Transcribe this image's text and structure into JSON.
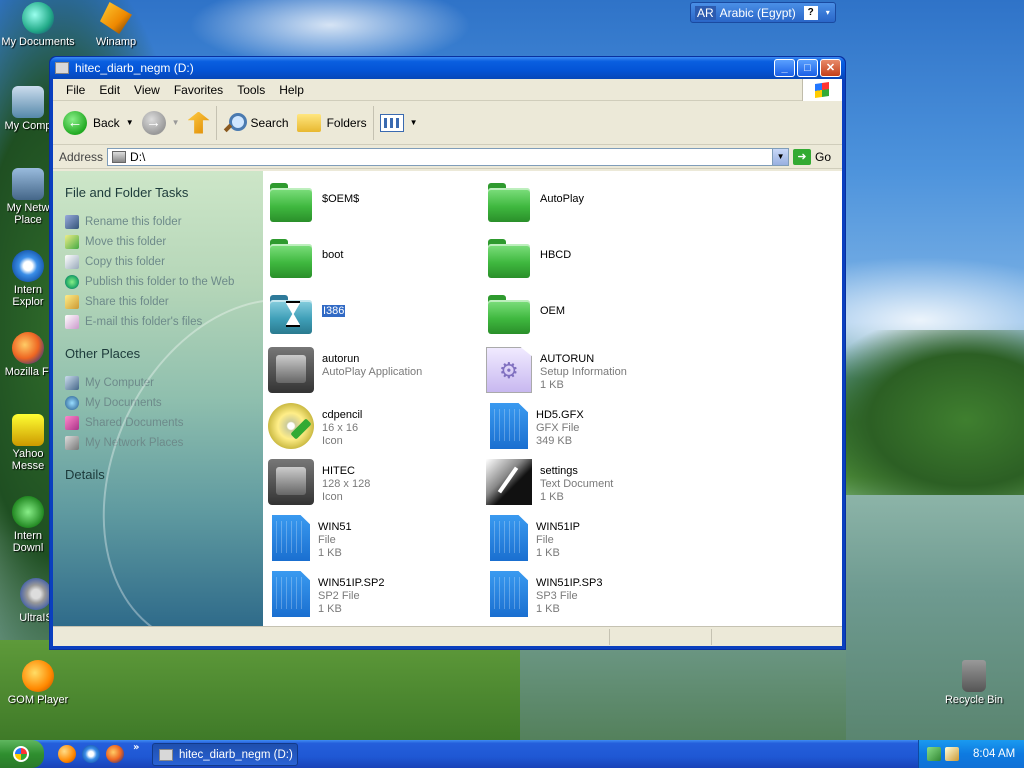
{
  "desktop": {
    "icons": [
      {
        "label": "My Documents",
        "icon": "my-documents-icon"
      },
      {
        "label": "Winamp",
        "icon": "winamp-icon"
      },
      {
        "label": "My Comp",
        "icon": "my-computer-icon"
      },
      {
        "label": "My Netw Place",
        "icon": "network-places-icon"
      },
      {
        "label": "Intern Explor",
        "icon": "internet-explorer-icon"
      },
      {
        "label": "Mozilla Fi",
        "icon": "firefox-icon"
      },
      {
        "label": "Yahoo Messe",
        "icon": "yahoo-messenger-icon"
      },
      {
        "label": "Intern Downl",
        "icon": "download-manager-icon"
      },
      {
        "label": "UltraIS",
        "icon": "ultraiso-icon"
      },
      {
        "label": "GOM Player",
        "icon": "gom-player-icon"
      },
      {
        "label": "Recycle Bin",
        "icon": "recycle-bin-icon"
      }
    ]
  },
  "language_bar": {
    "code": "AR",
    "language": "Arabic (Egypt)",
    "help": "?"
  },
  "window": {
    "title": "hitec_diarb_negm (D:)",
    "buttons": {
      "minimize": "_",
      "maximize": "□",
      "close": "✕"
    },
    "menu": [
      "File",
      "Edit",
      "View",
      "Favorites",
      "Tools",
      "Help"
    ],
    "toolbar": {
      "back": "Back",
      "search": "Search",
      "folders": "Folders"
    },
    "address": {
      "label": "Address",
      "value": "D:\\",
      "go": "Go"
    },
    "task_pane": {
      "file_tasks_title": "File and Folder Tasks",
      "file_tasks": [
        {
          "label": "Rename this folder",
          "icon": "rename-icon"
        },
        {
          "label": "Move this folder",
          "icon": "move-icon"
        },
        {
          "label": "Copy this folder",
          "icon": "copy-icon"
        },
        {
          "label": "Publish this folder to the Web",
          "icon": "publish-web-icon"
        },
        {
          "label": "Share this folder",
          "icon": "share-icon"
        },
        {
          "label": "E-mail this folder's files",
          "icon": "email-icon"
        }
      ],
      "other_places_title": "Other Places",
      "other_places": [
        {
          "label": "My Computer",
          "icon": "my-computer-icon"
        },
        {
          "label": "My Documents",
          "icon": "my-documents-icon"
        },
        {
          "label": "Shared Documents",
          "icon": "shared-documents-icon"
        },
        {
          "label": "My Network Places",
          "icon": "network-places-icon"
        }
      ],
      "details_title": "Details"
    },
    "files": [
      {
        "name": "$OEM$",
        "kind": "folder"
      },
      {
        "name": "AutoPlay",
        "kind": "folder"
      },
      {
        "name": "boot",
        "kind": "folder"
      },
      {
        "name": "HBCD",
        "kind": "folder"
      },
      {
        "name": "I386",
        "kind": "folder-busy",
        "selected": true
      },
      {
        "name": "OEM",
        "kind": "folder"
      },
      {
        "name": "autorun",
        "type": "AutoPlay Application",
        "size": "",
        "kind": "app"
      },
      {
        "name": "AUTORUN",
        "type": "Setup Information",
        "size": "1 KB",
        "kind": "setup"
      },
      {
        "name": "cdpencil",
        "type": "16 x 16",
        "size": "Icon",
        "kind": "cd"
      },
      {
        "name": "HD5.GFX",
        "type": "GFX File",
        "size": "349 KB",
        "kind": "file"
      },
      {
        "name": "HITEC",
        "type": "128 x 128",
        "size": "Icon",
        "kind": "app"
      },
      {
        "name": "settings",
        "type": "Text Document",
        "size": "1 KB",
        "kind": "doc"
      },
      {
        "name": "WIN51",
        "type": "File",
        "size": "1 KB",
        "kind": "file"
      },
      {
        "name": "WIN51IP",
        "type": "File",
        "size": "1 KB",
        "kind": "file"
      },
      {
        "name": "WIN51IP.SP2",
        "type": "SP2 File",
        "size": "1 KB",
        "kind": "file"
      },
      {
        "name": "WIN51IP.SP3",
        "type": "SP3 File",
        "size": "1 KB",
        "kind": "file"
      }
    ]
  },
  "taskbar": {
    "chevron": "»",
    "task_button": "hitec_diarb_negm (D:)",
    "clock": "8:04 AM"
  }
}
